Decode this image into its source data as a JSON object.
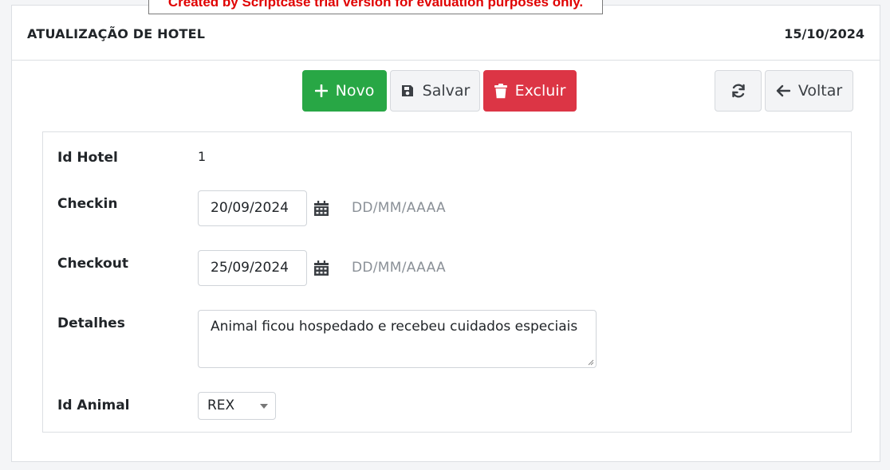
{
  "banner": {
    "text": "Created by Scriptcase trial version for evaluation purposes only."
  },
  "header": {
    "title": "ATUALIZAÇÃO DE HOTEL",
    "date": "15/10/2024"
  },
  "toolbar": {
    "novo_label": "Novo",
    "salvar_label": "Salvar",
    "excluir_label": "Excluir",
    "voltar_label": "Voltar"
  },
  "form": {
    "id_hotel": {
      "label": "Id Hotel",
      "value": "1"
    },
    "checkin": {
      "label": "Checkin",
      "value": "20/09/2024",
      "format_hint": "DD/MM/AAAA"
    },
    "checkout": {
      "label": "Checkout",
      "value": "25/09/2024",
      "format_hint": "DD/MM/AAAA"
    },
    "detalhes": {
      "label": "Detalhes",
      "value": "Animal ficou hospedado e recebeu cuidados especiais"
    },
    "id_animal": {
      "label": "Id Animal",
      "selected": "REX"
    }
  },
  "colors": {
    "success": "#28a745",
    "danger": "#dc3545",
    "banner_text": "#e00000"
  },
  "icons": [
    "plus-icon",
    "save-icon",
    "trash-icon",
    "refresh-icon",
    "arrow-left-icon",
    "calendar-icon"
  ]
}
